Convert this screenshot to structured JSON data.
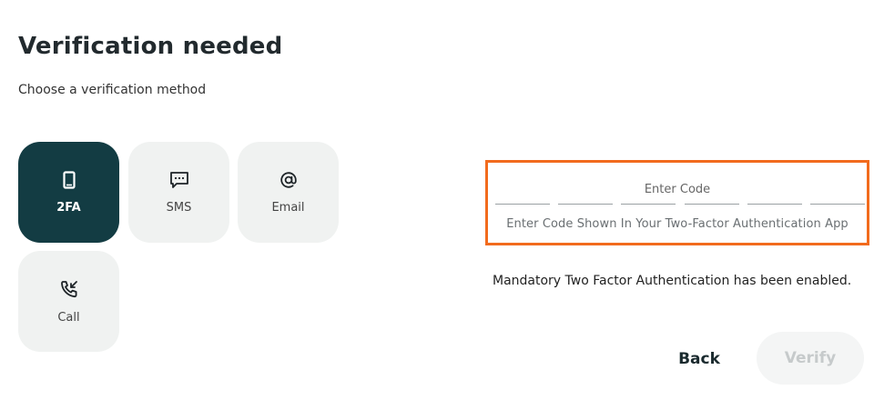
{
  "header": {
    "title": "Verification needed",
    "subtitle": "Choose a verification method"
  },
  "methods": [
    {
      "label": "2FA",
      "icon": "smartphone-icon",
      "selected": true
    },
    {
      "label": "SMS",
      "icon": "message-icon",
      "selected": false
    },
    {
      "label": "Email",
      "icon": "at-sign-icon",
      "selected": false
    },
    {
      "label": "Call",
      "icon": "phone-call-icon",
      "selected": false
    }
  ],
  "code": {
    "label": "Enter Code",
    "hint": "Enter Code Shown In Your Two-Factor Authentication App",
    "digits": 6,
    "value": ""
  },
  "notice": "Mandatory Two Factor Authentication has been enabled.",
  "actions": {
    "back_label": "Back",
    "verify_label": "Verify"
  },
  "colors": {
    "selected_bg": "#133c43",
    "tile_bg": "#f0f2f1",
    "highlight_border": "#f26b1d",
    "disabled_text": "#c6cacb"
  }
}
